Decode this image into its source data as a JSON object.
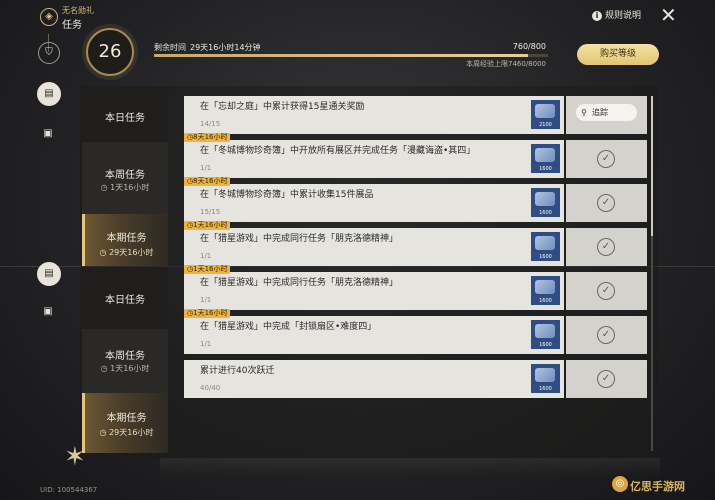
{
  "header": {
    "subtitle": "无名勋礼",
    "title": "任务",
    "help_label": "规则说明",
    "help_icon": "i",
    "close_icon": "✕"
  },
  "level": {
    "value": "26",
    "remaining_label": "剩余时间",
    "remaining_value": "29天16小时14分钟",
    "xp": "760/800",
    "xp_fraction": 0.95,
    "xp_cap": "本周经验上限7460/8000",
    "buy_button": "购买等级"
  },
  "categories": [
    {
      "label": "本日任务",
      "timer": ""
    },
    {
      "label": "本周任务",
      "timer": "1天16小时"
    },
    {
      "label": "本期任务",
      "timer": "29天16小时"
    },
    {
      "label": "本日任务",
      "timer": ""
    },
    {
      "label": "本周任务",
      "timer": "1天16小时"
    },
    {
      "label": "本期任务",
      "timer": "29天16小时"
    }
  ],
  "tasks": [
    {
      "tag": "",
      "text": "在「忘却之庭」中累计获得15星通关奖励",
      "progress": "14/15",
      "reward": "2100",
      "action": "追踪",
      "done": false
    },
    {
      "tag": "8天16小时",
      "text": "在「冬城博物珍奇簿」中开放所有展区并完成任务「漫藏诲盗•其四」",
      "progress": "1/1",
      "reward": "1600",
      "action": "",
      "done": true
    },
    {
      "tag": "8天16小时",
      "text": "在「冬城博物珍奇簿」中累计收集15件展品",
      "progress": "15/15",
      "reward": "1600",
      "action": "",
      "done": true
    },
    {
      "tag": "1天16小时",
      "text": "在「猎星游戏」中完成同行任务「朋克洛德精神」",
      "progress": "1/1",
      "reward": "1600",
      "action": "",
      "done": true
    },
    {
      "tag": "1天16小时",
      "text": "在「猎星游戏」中完成同行任务「朋克洛德精神」",
      "progress": "1/1",
      "reward": "1600",
      "action": "",
      "done": true
    },
    {
      "tag": "1天16小时",
      "text": "在「猎星游戏」中完成「封锁扇区•难度四」",
      "progress": "1/1",
      "reward": "1600",
      "action": "",
      "done": true
    },
    {
      "tag": "",
      "text": "累计进行40次跃迁",
      "progress": "40/40",
      "reward": "1600",
      "action": "",
      "done": true
    }
  ],
  "footer": {
    "uid": "UID: 100544367",
    "watermark": "亿思手游网"
  },
  "colors": {
    "accent": "#e3c77f",
    "tag": "#f0b43c",
    "reward_bg": "#2f4d82"
  },
  "icons": {
    "track": "location-pin-icon",
    "done": "check-circle-icon",
    "timer": "clock-icon"
  }
}
